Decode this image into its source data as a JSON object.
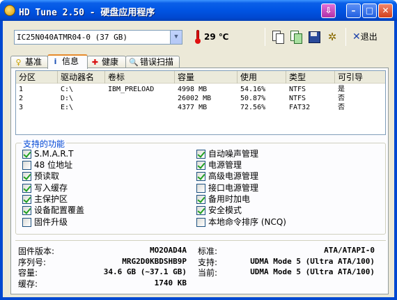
{
  "window": {
    "title": "HD Tune 2.50 - 硬盘应用程序",
    "title_color": "#0054e3"
  },
  "toolbar": {
    "drive": "IC25N040ATMR04-0 (37 GB)",
    "temperature": "29",
    "temperature_unit": "℃",
    "exit_label": "退出",
    "icons": [
      "copy-icon",
      "copy-all-icon",
      "save-icon",
      "options-icon"
    ]
  },
  "tabs": [
    {
      "label": "基准",
      "icon": "benchmark-icon",
      "active": false
    },
    {
      "label": "信息",
      "icon": "info-icon",
      "active": true
    },
    {
      "label": "健康",
      "icon": "health-icon",
      "active": false
    },
    {
      "label": "错误扫描",
      "icon": "search-icon",
      "active": false
    }
  ],
  "partitions": {
    "headers": [
      "分区",
      "驱动器名",
      "卷标",
      "容量",
      "使用",
      "类型",
      "可引导"
    ],
    "rows": [
      [
        "1",
        "C:\\",
        "IBM_PRELOAD",
        "4998 MB",
        "54.16%",
        "NTFS",
        "是"
      ],
      [
        "2",
        "D:\\",
        "",
        "26002 MB",
        "50.87%",
        "NTFS",
        "否"
      ],
      [
        "3",
        "E:\\",
        "",
        "4377 MB",
        "72.56%",
        "FAT32",
        "否"
      ]
    ]
  },
  "features": {
    "title": "支持的功能",
    "items": [
      {
        "label": "S.M.A.R.T",
        "checked": true
      },
      {
        "label": "48 位地址",
        "checked": false
      },
      {
        "label": "预读取",
        "checked": true
      },
      {
        "label": "写入缓存",
        "checked": true
      },
      {
        "label": "主保护区",
        "checked": true
      },
      {
        "label": "设备配置覆盖",
        "checked": true
      },
      {
        "label": "固件升级",
        "checked": false
      },
      {
        "label": "自动噪声管理",
        "checked": true
      },
      {
        "label": "电源管理",
        "checked": true
      },
      {
        "label": "高级电源管理",
        "checked": true
      },
      {
        "label": "接口电源管理",
        "checked": false
      },
      {
        "label": "备用时加电",
        "checked": true
      },
      {
        "label": "安全模式",
        "checked": true
      },
      {
        "label": "本地命令排序 (NCQ)",
        "checked": false
      }
    ]
  },
  "drive_info": {
    "firmware_label": "固件版本:",
    "firmware": "MO2OAD4A",
    "serial_label": "序列号:",
    "serial": "MRG2D0KBDSHB9P",
    "capacity_label": "容量:",
    "capacity": "34.6 GB (~37.1 GB)",
    "buffer_label": "缓存:",
    "buffer": "1740 KB",
    "standard_label": "标准:",
    "standard": "ATA/ATAPI-0",
    "supported_label": "支持:",
    "supported": "UDMA Mode 5 (Ultra ATA/100)",
    "current_label": "当前:",
    "current": "UDMA Mode 5 (Ultra ATA/100)"
  }
}
